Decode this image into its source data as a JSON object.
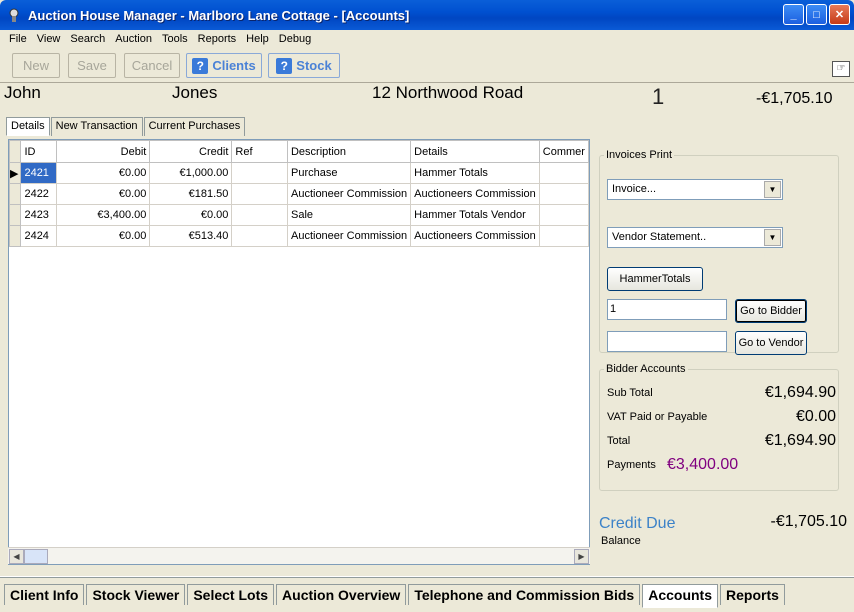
{
  "window": {
    "title": "Auction House Manager - Marlboro Lane Cottage - [Accounts]"
  },
  "menu": [
    "File",
    "View",
    "Search",
    "Auction",
    "Tools",
    "Reports",
    "Help",
    "Debug"
  ],
  "toolbar": {
    "new": "New",
    "save": "Save",
    "cancel": "Cancel",
    "clients": "Clients",
    "stock": "Stock"
  },
  "header": {
    "first": "John",
    "last": "Jones",
    "address": "12 Northwood Road",
    "number": "1",
    "balance": "-€1,705.10"
  },
  "tabs": [
    "Details",
    "New Transaction",
    "Current Purchases"
  ],
  "grid": {
    "columns": [
      "ID",
      "Debit",
      "Credit",
      "Ref",
      "Description",
      "Details",
      "Commer"
    ],
    "rows": [
      {
        "id": "2421",
        "debit": "€0.00",
        "credit": "€1,000.00",
        "ref": "",
        "description": "Purchase",
        "details": "Hammer Totals",
        "comment": ""
      },
      {
        "id": "2422",
        "debit": "€0.00",
        "credit": "€181.50",
        "ref": "",
        "description": "Auctioneer Commission",
        "details": "Auctioneers Commission",
        "comment": ""
      },
      {
        "id": "2423",
        "debit": "€3,400.00",
        "credit": "€0.00",
        "ref": "",
        "description": "Sale",
        "details": "Hammer Totals Vendor",
        "comment": ""
      },
      {
        "id": "2424",
        "debit": "€0.00",
        "credit": "€513.40",
        "ref": "",
        "description": "Auctioneer Commission",
        "details": "Auctioneers Commission",
        "comment": ""
      }
    ]
  },
  "invoices": {
    "legend": "Invoices Print",
    "invoice_select": "Invoice...",
    "vendor_select": "Vendor Statement..",
    "hammer_button": "HammerTotals",
    "bidder_input": "1",
    "go_bidder": "Go to Bidder",
    "vendor_input": "",
    "go_vendor": "Go to Vendor"
  },
  "accounts": {
    "legend": "Bidder Accounts",
    "subtotal_label": "Sub Total",
    "subtotal": "€1,694.90",
    "vat_label": "VAT Paid or Payable",
    "vat": "€0.00",
    "total_label": "Total",
    "total": "€1,694.90",
    "payments_label": "Payments",
    "payments": "€3,400.00",
    "payments_color": "#800080"
  },
  "credit": {
    "label": "Credit Due",
    "value": "-€1,705.10",
    "balance_label": "Balance",
    "label_color": "#3c82c8"
  },
  "bottom_tabs": [
    "Client Info",
    "Stock Viewer",
    "Select Lots",
    "Auction Overview",
    "Telephone and Commission Bids",
    "Accounts",
    "Reports"
  ]
}
